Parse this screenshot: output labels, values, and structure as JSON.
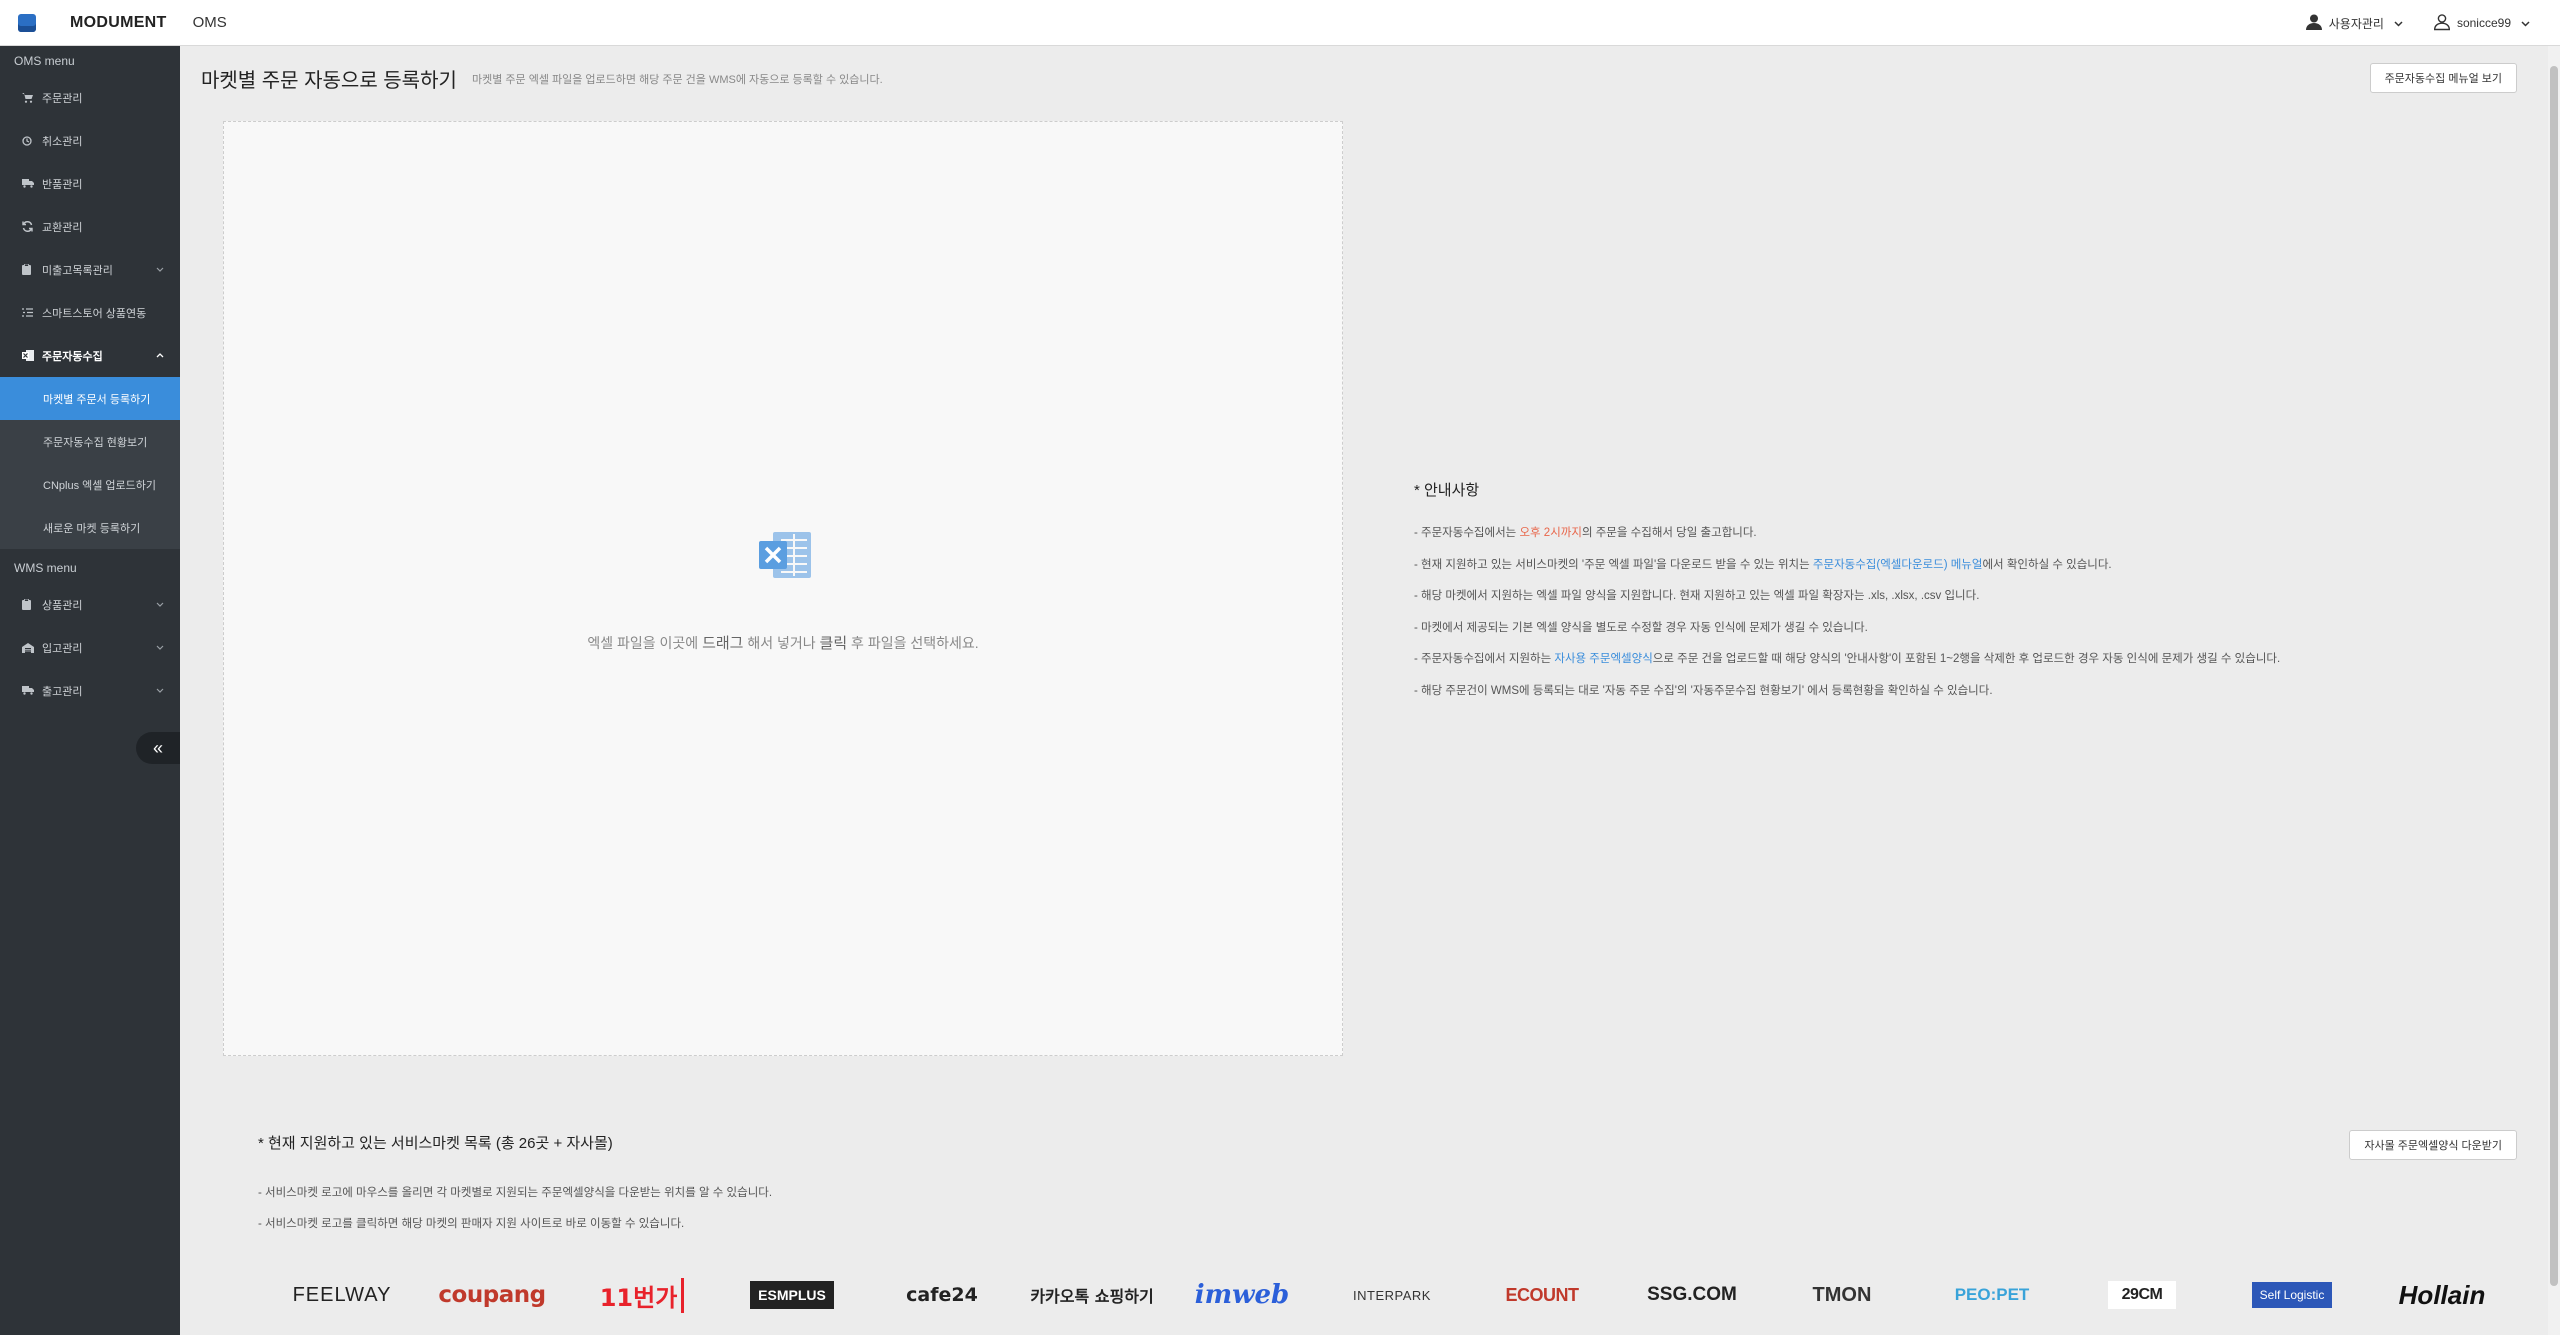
{
  "header": {
    "brand": "MODUMENT",
    "app": "OMS",
    "user_admin": "사용자관리",
    "username": "sonicce99"
  },
  "sidebar": {
    "oms_section": "OMS menu",
    "oms_items": [
      {
        "label": "주문관리",
        "icon": "cart-icon"
      },
      {
        "label": "취소관리",
        "icon": "clock-icon"
      },
      {
        "label": "반품관리",
        "icon": "truck-icon"
      },
      {
        "label": "교환관리",
        "icon": "refresh-icon"
      },
      {
        "label": "미출고목록관리",
        "icon": "clipboard-icon"
      },
      {
        "label": "스마트스토어 상품연동",
        "icon": "list-icon"
      },
      {
        "label": "주문자동수집",
        "icon": "excel-icon"
      }
    ],
    "sub_items": [
      {
        "label": "마켓별 주문서 등록하기"
      },
      {
        "label": "주문자동수집 현황보기"
      },
      {
        "label": "CNplus 엑셀 업로드하기"
      },
      {
        "label": "새로운 마켓 등록하기"
      }
    ],
    "wms_section": "WMS menu",
    "wms_items": [
      {
        "label": "상품관리",
        "icon": "clipboard-icon"
      },
      {
        "label": "입고관리",
        "icon": "warehouse-icon"
      },
      {
        "label": "출고관리",
        "icon": "truck-icon"
      }
    ],
    "collapse": "«"
  },
  "main": {
    "title": "마켓별 주문 자동으로 등록하기",
    "description": "마켓별 주문 엑셀 파일을 업로드하면 해당 주문 건을 WMS에 자동으로 등록할 수 있습니다.",
    "manual_button": "주문자동수집 메뉴얼 보기",
    "dropzone": {
      "p1": "엑셀 파일을 이곳에 ",
      "em1": "드래그",
      "p2": " 해서 넣거나 ",
      "em2": "클릭",
      "p3": " 후 파일을 선택하세요."
    },
    "notice": {
      "title": "* 안내사항",
      "l1a": "- 주문자동수집에서는 ",
      "l1b": "오후 2시까지",
      "l1c": "의 주문을 수집해서 당일 출고합니다.",
      "l2a": "- 현재 지원하고 있는 서비스마켓의 '주문 엑셀 파일'을 다운로드 받을 수 있는 위치는 ",
      "l2b": "주문자동수집(엑셀다운로드) 메뉴얼",
      "l2c": "에서 확인하실 수 있습니다.",
      "l3": "- 해당 마켓에서 지원하는 엑셀 파일 양식을 지원합니다. 현재 지원하고 있는 엑셀 파일 확장자는 .xls, .xlsx, .csv 입니다.",
      "l4": "- 마켓에서 제공되는 기본 엑셀 양식을 별도로 수정할 경우 자동 인식에 문제가 생길 수 있습니다.",
      "l5a": "- 주문자동수집에서 지원하는 ",
      "l5b": "자사용 주문엑셀양식",
      "l5c": "으로 주문 건을 업로드할 때 해당 양식의 '안내사항'이 포함된 1~2행을 삭제한 후 업로드한 경우 자동 인식에 문제가 생길 수 있습니다.",
      "l6": "- 해당 주문건이 WMS에 등록되는 대로 '자동 주문 수집'의 '자동주문수집 현황보기' 에서 등록현황을 확인하실 수 있습니다."
    },
    "markets": {
      "title": "* 현재 지원하고 있는 서비스마켓 목록 (총 26곳 + 자사몰)",
      "desc1": "- 서비스마켓 로고에 마우스를 올리면 각 마켓별로 지원되는 주문엑셀양식을 다운받는 위치를 알 수 있습니다.",
      "desc2": "- 서비스마켓 로고를 클릭하면 해당 마켓의 판매자 지원 사이트로 바로 이동할 수 있습니다.",
      "download_button": "자사몰 주문엑셀양식 다운받기",
      "logos": [
        "FEELWAY",
        "coupang",
        "11번가",
        "ESMPLUS",
        "cafe24",
        "카카오톡 쇼핑하기",
        "imweb",
        "INTERPARK",
        "ECOUNT",
        "SSG.COM",
        "TMON",
        "PEO:PET",
        "29CM",
        "Self Logistic",
        "Hollain"
      ]
    }
  }
}
